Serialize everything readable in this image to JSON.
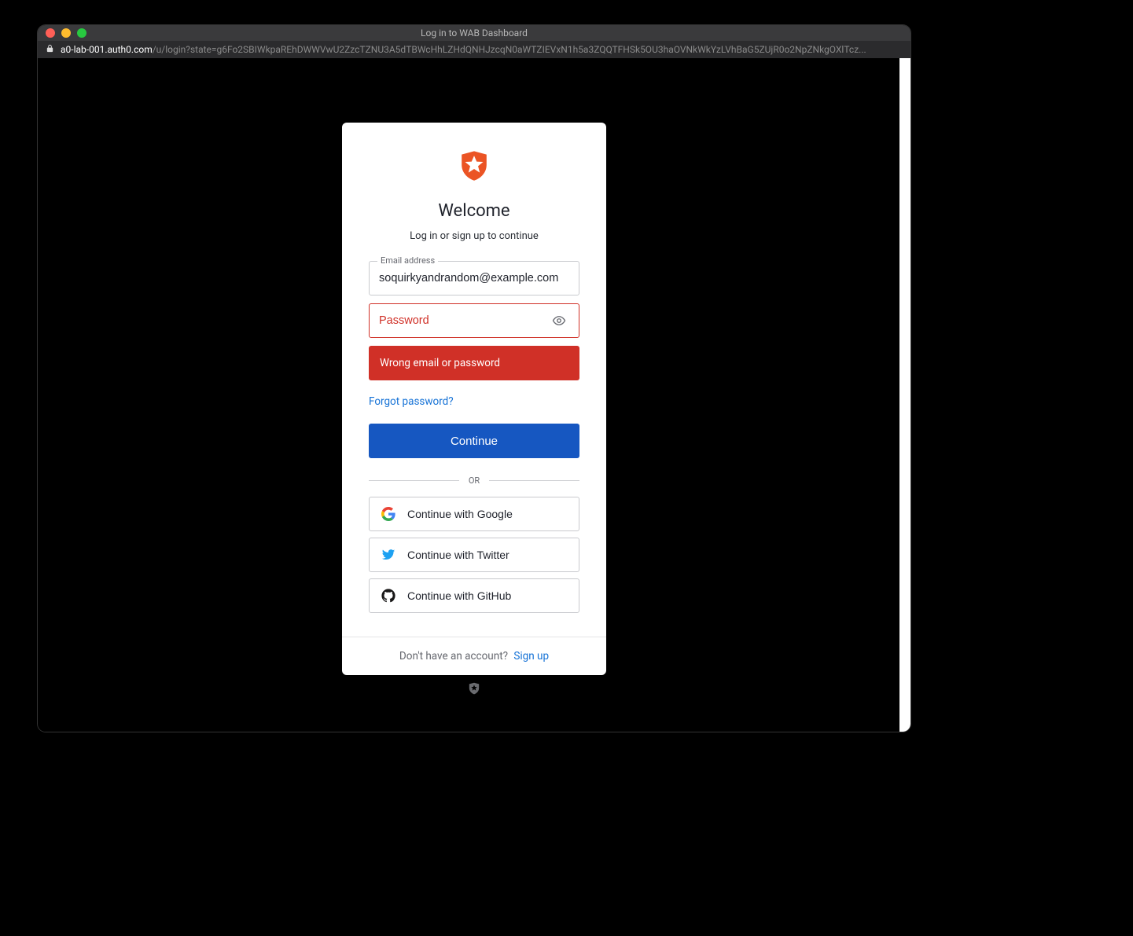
{
  "window": {
    "title": "Log in to WAB Dashboard",
    "url_host": "a0-lab-001.auth0.com",
    "url_path": "/u/login?state=g6Fo2SBIWkpaREhDWWVwU2ZzcTZNU3A5dTBWcHhLZHdQNHJzcqN0aWTZIEVxN1h5a3ZQQTFHSk5OU3haOVNkWkYzLVhBaG5ZUjR0o2NpZNkgOXlTcz..."
  },
  "card": {
    "welcome": "Welcome",
    "subtitle": "Log in or sign up to continue",
    "email_label": "Email address",
    "email_value": "soquirkyandrandom@example.com",
    "password_placeholder": "Password",
    "password_value": "",
    "error_message": "Wrong email or password",
    "forgot_label": "Forgot password?",
    "continue_label": "Continue",
    "divider_label": "OR",
    "social": {
      "google": "Continue with Google",
      "twitter": "Continue with Twitter",
      "github": "Continue with GitHub"
    }
  },
  "footer": {
    "prompt": "Don't have an account?",
    "signup_label": "Sign up"
  },
  "colors": {
    "accent": "#1657c1",
    "error": "#d03027",
    "brand": "#eb5424"
  }
}
